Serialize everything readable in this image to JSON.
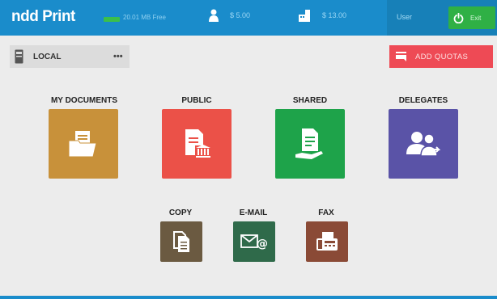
{
  "header": {
    "logo": "ndd Print",
    "free_space": "20.01 MB Free",
    "balance_user": "$ 5.00",
    "balance_group": "$ 13.00",
    "user_label": "User",
    "exit_label": "Exit"
  },
  "location": {
    "label": "LOCAL",
    "more": "•••"
  },
  "add_quotas": "ADD QUOTAS",
  "tiles": [
    {
      "label": "MY DOCUMENTS",
      "color": "#c8913a",
      "icon": "folder-document-icon"
    },
    {
      "label": "PUBLIC",
      "color": "#eb5148",
      "icon": "public-document-icon"
    },
    {
      "label": "SHARED",
      "color": "#1ea34a",
      "icon": "shared-document-icon"
    },
    {
      "label": "DELEGATES",
      "color": "#5a53a7",
      "icon": "users-icon"
    }
  ],
  "actions": [
    {
      "label": "COPY",
      "color": "#6b5a41",
      "icon": "copy-icon"
    },
    {
      "label": "E-MAIL",
      "color": "#2f6a4a",
      "icon": "email-icon"
    },
    {
      "label": "FAX",
      "color": "#8a4a36",
      "icon": "fax-icon"
    }
  ],
  "colors": {
    "topbar": "#1a8ccb",
    "exit": "#2fb045",
    "quotas": "#ee4a55"
  }
}
